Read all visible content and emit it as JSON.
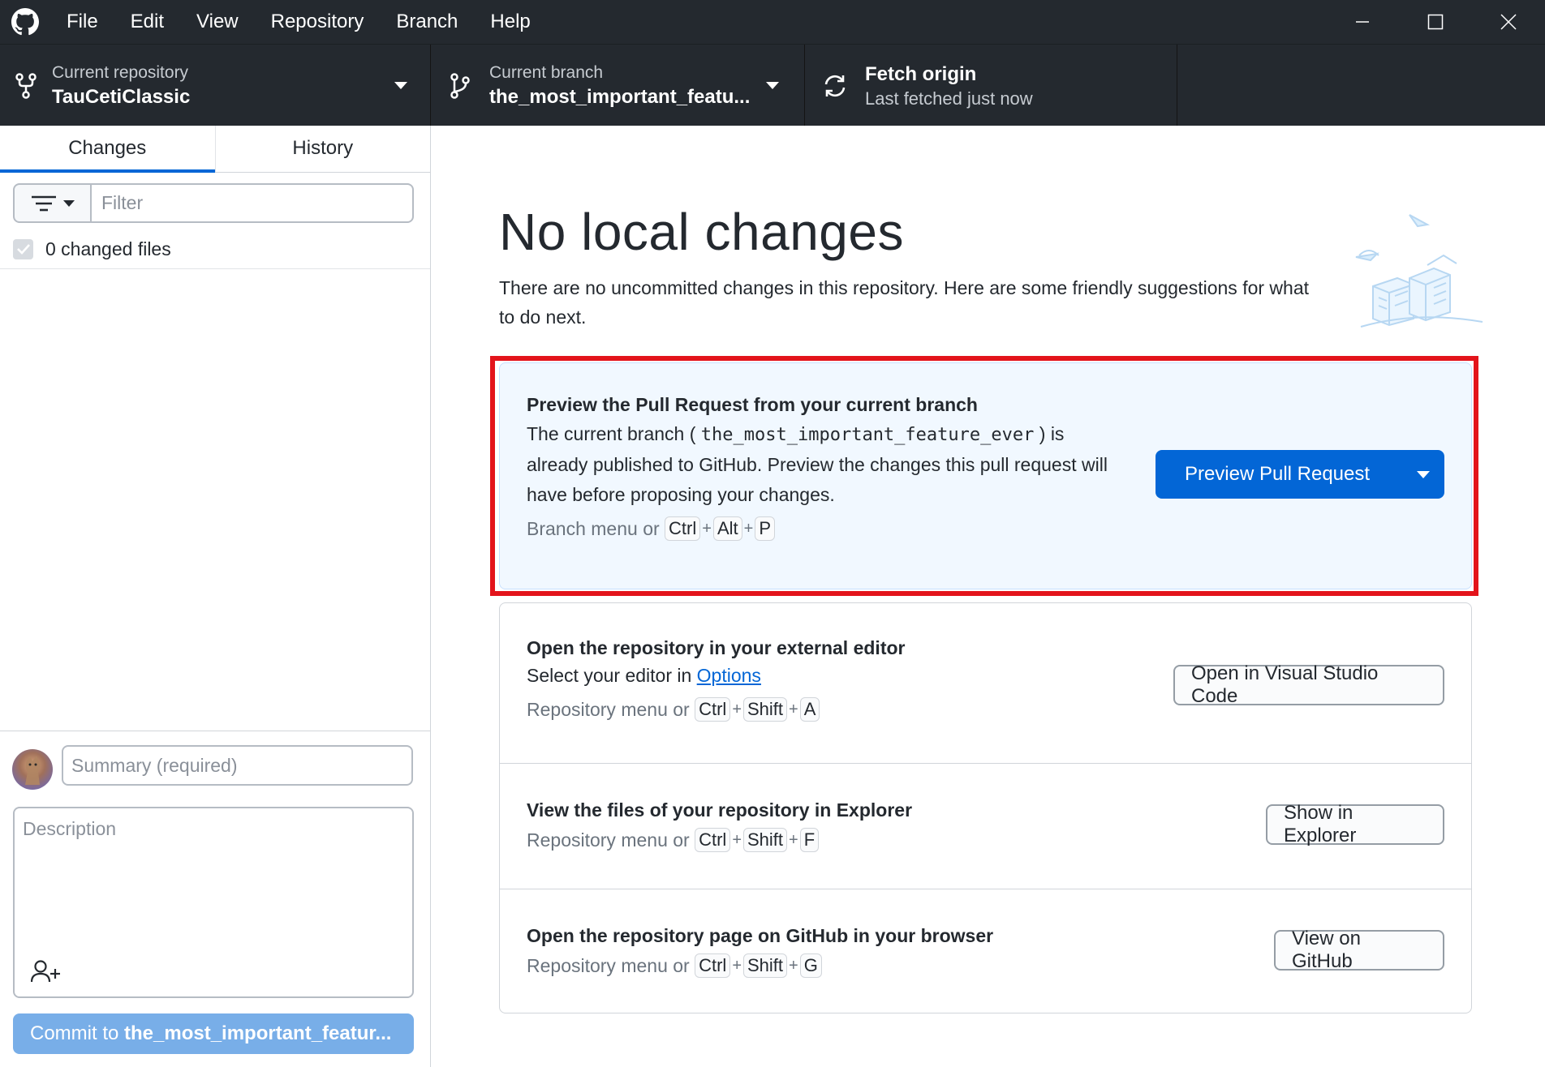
{
  "menu": {
    "items": [
      "File",
      "Edit",
      "View",
      "Repository",
      "Branch",
      "Help"
    ]
  },
  "window_controls": [
    "minimize-icon",
    "maximize-icon",
    "close-icon"
  ],
  "toolbar": {
    "repo_label": "Current repository",
    "repo_value": "TauCetiClassic",
    "branch_label": "Current branch",
    "branch_value": "the_most_important_featu...",
    "fetch_label": "Fetch origin",
    "fetch_status": "Last fetched just now"
  },
  "sidebar": {
    "tabs": [
      "Changes",
      "History"
    ],
    "active_tab": "Changes",
    "filter_placeholder": "Filter",
    "changed_files": "0 changed files",
    "summary_placeholder": "Summary (required)",
    "description_placeholder": "Description",
    "commit_prefix": "Commit to ",
    "commit_branch": "the_most_important_featur..."
  },
  "main": {
    "title": "No local changes",
    "subtitle": "There are no uncommitted changes in this repository. Here are some friendly suggestions for what to do next.",
    "pr_card": {
      "title": "Preview the Pull Request from your current branch",
      "text_before": "The current branch (",
      "branch": "the_most_important_feature_ever",
      "text_after": ") is already published to GitHub. Preview the changes this pull request will have before proposing your changes.",
      "hint_prefix": "Branch menu or",
      "keys": [
        "Ctrl",
        "Alt",
        "P"
      ],
      "button": "Preview Pull Request"
    },
    "editor_row": {
      "title": "Open the repository in your external editor",
      "text_prefix": "Select your editor in ",
      "link": "Options",
      "hint_prefix": "Repository menu or",
      "keys": [
        "Ctrl",
        "Shift",
        "A"
      ],
      "button": "Open in Visual Studio Code"
    },
    "explorer_row": {
      "title": "View the files of your repository in Explorer",
      "hint_prefix": "Repository menu or",
      "keys": [
        "Ctrl",
        "Shift",
        "F"
      ],
      "button": "Show in Explorer"
    },
    "github_row": {
      "title": "Open the repository page on GitHub in your browser",
      "hint_prefix": "Repository menu or",
      "keys": [
        "Ctrl",
        "Shift",
        "G"
      ],
      "button": "View on GitHub"
    }
  },
  "colors": {
    "titlebar": "#24292f",
    "accent": "#0366d6",
    "highlight_border": "#e3141b",
    "commit_button": "#78aee8",
    "pr_card_bg": "#f1f8ff"
  }
}
